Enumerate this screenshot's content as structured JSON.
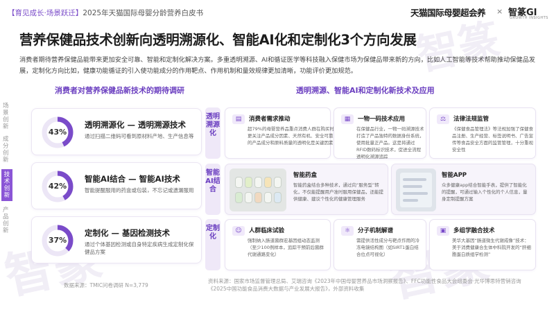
{
  "header": {
    "crumb_bracket_text": "【育见成长·场景跃迁】",
    "crumb_rest": "2025年天猫国际母婴分龄营养白皮书",
    "brand_main": "天猫国际母婴超会养",
    "brand_x": "×",
    "brand_partner": "智篆GI",
    "brand_partner_sub": "GROWTH INSIGHTS"
  },
  "title": "营养保健品技术创新向透明溯源化、智能AI化和定制化3个方向发展",
  "description": "消费者期待营养保健品能带来更加安全可靠、智能和定制化解决方案。多重透明溯源、AI和循证医学等科技融入保健市场为保健品带来新的方向，比如人工智能等技术帮助推动保健品发展，定制化方向比如，健康功能循证的引入使功能成分的作用靶点、作用机制和量效规律更加清晰，功能评价更加规范。",
  "sidenav": [
    {
      "label": "场景创新",
      "active": false
    },
    {
      "label": "成分创新",
      "active": false
    },
    {
      "label": "技术创新",
      "active": true
    },
    {
      "label": "产品创新",
      "active": false
    }
  ],
  "left_section": {
    "heading": "消费者对营养保健品新技术的期待调研",
    "cards": [
      {
        "percent": 43,
        "percent_label": "43%",
        "title": "透明溯源化 — 透明溯源技术",
        "text": "通过扫描二维码可看到原材料产地、生产信息等"
      },
      {
        "percent": 42,
        "percent_label": "42%",
        "title": "智能AI结合 — 智能AI技术",
        "text": "智能提醒服用的药盒或包装，不忘记或遗漏服用"
      },
      {
        "percent": 37,
        "percent_label": "37%",
        "title": "定制化 — 基因检测技术",
        "text": "通过个体基因检测或自身特定疾病生成定制化保健品方案"
      }
    ],
    "source": "数据来源：TMIC问卷调研 N=3,779"
  },
  "right_section": {
    "heading": "透明溯源、智能AI和定制化新技术及应用",
    "rows": [
      {
        "label": "透明溯源化",
        "cards": [
          {
            "icon": "document-icon",
            "title": "消费者需求推动",
            "text": "超79%的母婴营养品重点消费人群在购买时更关注产品成分因素、天然有机、安全可靠的产品成分和原料质量的透明化是关键因素"
          },
          {
            "icon": "qr-code-icon",
            "title": "一物一码技术应用",
            "text": "在保健品行业，一物一码溯源技术打造了产品独特的数据身份系统，使用批量正产品。这是将通过RFID数码标识技术，促进全流程透明化溯源追踪"
          },
          {
            "icon": "gavel-icon",
            "title": "法律法规监管",
            "text": "《保健食品管理法》等法规加强了保健食品注册、生产经营、标签说明书、广告宣传等食品安全方面的监管管理，十分重视安全性"
          }
        ]
      },
      {
        "label": "智能AI结合",
        "cards": [
          {
            "title": "智能药盒",
            "text": "智能药盒结合多种技术，通过向“服务型”转化，不仅能提醒用户准时服用保健品，还能提供健康、建议个性化的健康管理服务"
          },
          {
            "title": "智能APP",
            "text": "众多健康app结合智能手表，提供了智能化的提醒，可通过输入个性化的个人信息，量身定制提醒方案"
          }
        ]
      },
      {
        "label": "定制化",
        "cards": [
          {
            "icon": "person-icon",
            "title": "人群临床试验",
            "text": "强制纳入肠道菌群宏基因组动态监测（至少100例样本，追踪干预前后菌群代谢通路变化）"
          },
          {
            "icon": "molecule-icon",
            "title": "分子机制解谱",
            "text": "需提供活性成分与靶点作用的冷冻电镜结构图（如SIRT1蛋白结合位点可视化）"
          },
          {
            "icon": "cubes-icon",
            "title": "多组学融合技术",
            "text": "美华大基因“肠道微生代谢成像”技术：美于消费健康合生体中科院开发的“肝细胞蛋白质组学检测”"
          }
        ]
      }
    ],
    "source": "资料来源：国家市场监督管理总局、艾瑞咨询《2023年中国母婴营养品市场洞察报告》、FFC功能性食品大会组委会·光华博思特营销咨询《2025中国功能食品消费大数据与产业发展大报告》，外部资料收集"
  },
  "colors": {
    "accent": "#7a4bc9",
    "donut_fill": "#7a4bc9",
    "donut_track": "#ece6f6"
  }
}
